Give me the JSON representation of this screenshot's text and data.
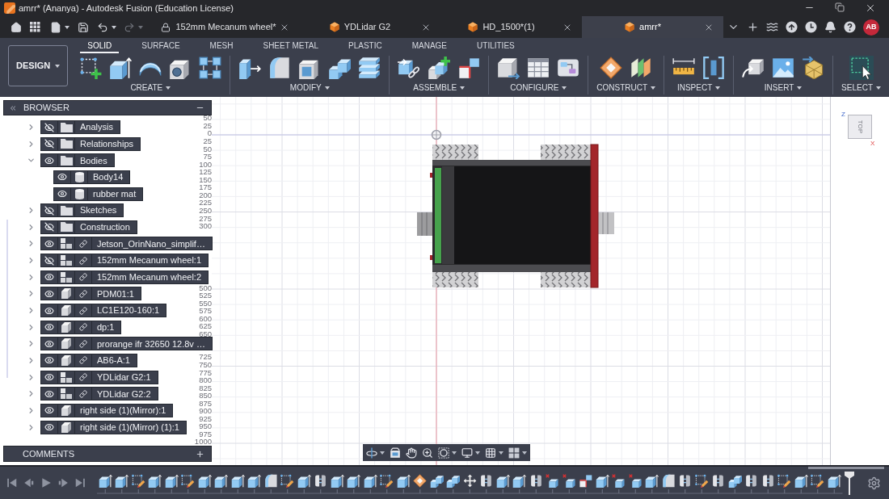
{
  "window": {
    "title": "amrr* (Ananya) - Autodesk Fusion (Education License)"
  },
  "quick_access": [
    {
      "kind": "home",
      "menu": false,
      "disabled": false
    },
    {
      "kind": "apps",
      "menu": false,
      "disabled": false
    },
    {
      "kind": "file",
      "menu": true,
      "disabled": false
    },
    {
      "kind": "save",
      "menu": false,
      "disabled": false
    },
    {
      "kind": "undo",
      "menu": true,
      "disabled": false
    },
    {
      "kind": "redo",
      "menu": true,
      "disabled": true
    }
  ],
  "document_tabs": [
    {
      "label": "152mm Mecanum wheel*",
      "kind": "locked",
      "selected": false
    },
    {
      "label": "YDLidar G2",
      "kind": "design",
      "selected": false
    },
    {
      "label": "HD_1500*(1)",
      "kind": "design",
      "selected": false
    },
    {
      "label": "amrr*",
      "kind": "design",
      "selected": true
    }
  ],
  "user": {
    "initials": "AB"
  },
  "toolbar": {
    "workspace": "DESIGN",
    "tabs": [
      {
        "label": "SOLID",
        "selected": true
      },
      {
        "label": "SURFACE",
        "selected": false
      },
      {
        "label": "MESH",
        "selected": false
      },
      {
        "label": "SHEET METAL",
        "selected": false
      },
      {
        "label": "PLASTIC",
        "selected": false
      },
      {
        "label": "MANAGE",
        "selected": false
      },
      {
        "label": "UTILITIES",
        "selected": false
      }
    ],
    "groups": [
      {
        "label": "CREATE",
        "tools": [
          {
            "kind": "sketch"
          },
          {
            "kind": "extrude"
          },
          {
            "kind": "revolve"
          },
          {
            "kind": "hole"
          },
          {
            "kind": "pattern"
          }
        ]
      },
      {
        "label": "MODIFY",
        "tools": [
          {
            "kind": "presspull"
          },
          {
            "kind": "fillet"
          },
          {
            "kind": "shell"
          },
          {
            "kind": "combine"
          },
          {
            "kind": "layers"
          }
        ]
      },
      {
        "label": "ASSEMBLE",
        "tools": [
          {
            "kind": "component"
          },
          {
            "kind": "newcomponent"
          },
          {
            "kind": "corner"
          }
        ]
      },
      {
        "label": "CONFIGURE",
        "tools": [
          {
            "kind": "parameters"
          },
          {
            "kind": "table"
          },
          {
            "kind": "configure"
          }
        ]
      },
      {
        "label": "CONSTRUCT",
        "tools": [
          {
            "kind": "plane"
          },
          {
            "kind": "midplane"
          }
        ]
      },
      {
        "label": "INSPECT",
        "tools": [
          {
            "kind": "measure"
          },
          {
            "kind": "interference"
          }
        ]
      },
      {
        "label": "INSERT",
        "tools": [
          {
            "kind": "derive"
          },
          {
            "kind": "canvas"
          },
          {
            "kind": "mesh"
          }
        ]
      },
      {
        "label": "SELECT",
        "tools": [
          {
            "kind": "select"
          }
        ]
      }
    ]
  },
  "browser": {
    "title": "BROWSER",
    "items": [
      {
        "label": "Analysis",
        "kind": "folder",
        "visible": false,
        "linked": false,
        "expanded": false
      },
      {
        "label": "Relationships",
        "kind": "folder",
        "visible": false,
        "linked": false,
        "expanded": false
      },
      {
        "label": "Bodies",
        "kind": "folder",
        "visible": true,
        "linked": false,
        "expanded": true,
        "children": [
          {
            "label": "Body14",
            "kind": "body",
            "visible": true
          },
          {
            "label": "rubber mat",
            "kind": "body",
            "visible": true
          }
        ]
      },
      {
        "label": "Sketches",
        "kind": "folder",
        "visible": false,
        "linked": false,
        "expanded": false
      },
      {
        "label": "Construction",
        "kind": "folder",
        "visible": false,
        "linked": false,
        "expanded": false
      },
      {
        "label": "Jetson_OrinNano_simplif…",
        "kind": "assembly",
        "visible": true,
        "linked": true,
        "expanded": false
      },
      {
        "label": "152mm Mecanum wheel:1",
        "kind": "assembly",
        "visible": false,
        "linked": true,
        "expanded": false
      },
      {
        "label": "152mm Mecanum wheel:2",
        "kind": "assembly",
        "visible": true,
        "linked": true,
        "expanded": false
      },
      {
        "label": "PDM01:1",
        "kind": "component",
        "visible": true,
        "linked": true,
        "expanded": false
      },
      {
        "label": "LC1E120-160:1",
        "kind": "component",
        "visible": true,
        "linked": true,
        "expanded": false
      },
      {
        "label": "dp:1",
        "kind": "component",
        "visible": true,
        "linked": true,
        "expanded": false
      },
      {
        "label": "prorange ifr 32650 12.8v …",
        "kind": "component",
        "visible": true,
        "linked": true,
        "expanded": false
      },
      {
        "label": "AB6-A:1",
        "kind": "component",
        "visible": true,
        "linked": true,
        "expanded": false
      },
      {
        "label": "YDLidar G2:1",
        "kind": "assembly",
        "visible": true,
        "linked": true,
        "expanded": false
      },
      {
        "label": "YDLidar G2:2",
        "kind": "assembly",
        "visible": true,
        "linked": true,
        "expanded": false
      },
      {
        "label": "right side (1)(Mirror):1",
        "kind": "component",
        "visible": true,
        "linked": false,
        "expanded": false
      },
      {
        "label": "right side (1)(Mirror) (1):1",
        "kind": "component",
        "visible": true,
        "linked": false,
        "expanded": false
      }
    ]
  },
  "comments": {
    "title": "COMMENTS"
  },
  "viewport": {
    "ruler_runs": [
      [
        "50",
        "25",
        "0",
        "25",
        "50",
        "75",
        "100",
        "125",
        "150",
        "175",
        "200",
        "225",
        "250",
        "275",
        "300"
      ],
      [
        "500",
        "525",
        "550",
        "575",
        "600",
        "625",
        "650"
      ],
      [
        "725",
        "750",
        "775",
        "800",
        "825",
        "850",
        "875",
        "900",
        "925",
        "950",
        "975",
        "1000"
      ]
    ],
    "view_cube": {
      "face": "TOP",
      "axes": [
        "Z",
        "X"
      ]
    }
  },
  "navigation_bar": {
    "tools": [
      {
        "kind": "orbit",
        "menu": true
      },
      {
        "kind": "lookat",
        "menu": false
      },
      {
        "kind": "pan",
        "menu": false
      },
      {
        "kind": "zoom",
        "menu": false
      },
      {
        "kind": "fit",
        "menu": true
      },
      {
        "kind": "display",
        "menu": true
      },
      {
        "kind": "grid",
        "menu": true
      },
      {
        "kind": "viewports",
        "menu": true
      }
    ]
  },
  "timeline": {
    "features": [
      {
        "kind": "extrude"
      },
      {
        "kind": "extrude"
      },
      {
        "kind": "sketchedit"
      },
      {
        "kind": "extrude"
      },
      {
        "kind": "extrude"
      },
      {
        "kind": "sketchedit"
      },
      {
        "kind": "extrude"
      },
      {
        "kind": "extrude"
      },
      {
        "kind": "extrude"
      },
      {
        "kind": "extrude"
      },
      {
        "kind": "fillet"
      },
      {
        "kind": "sketchedit"
      },
      {
        "kind": "extrude"
      },
      {
        "kind": "pair"
      },
      {
        "kind": "extrude"
      },
      {
        "kind": "extrude"
      },
      {
        "kind": "extrude"
      },
      {
        "kind": "sketchedit"
      },
      {
        "kind": "extrude"
      },
      {
        "kind": "plane"
      },
      {
        "kind": "combine"
      },
      {
        "kind": "combine"
      },
      {
        "kind": "move"
      },
      {
        "kind": "pair"
      },
      {
        "kind": "extrude"
      },
      {
        "kind": "extrude"
      },
      {
        "kind": "pair"
      },
      {
        "kind": "remove"
      },
      {
        "kind": "remove"
      },
      {
        "kind": "corner"
      },
      {
        "kind": "extrude"
      },
      {
        "kind": "remove"
      },
      {
        "kind": "remove"
      },
      {
        "kind": "extrude"
      },
      {
        "kind": "fillet"
      },
      {
        "kind": "pair"
      },
      {
        "kind": "sketchedit"
      },
      {
        "kind": "pair"
      },
      {
        "kind": "combine"
      },
      {
        "kind": "pair"
      },
      {
        "kind": "pair"
      },
      {
        "kind": "sketchedit"
      },
      {
        "kind": "extrude"
      },
      {
        "kind": "sketchedit"
      },
      {
        "kind": "extrude"
      }
    ]
  }
}
